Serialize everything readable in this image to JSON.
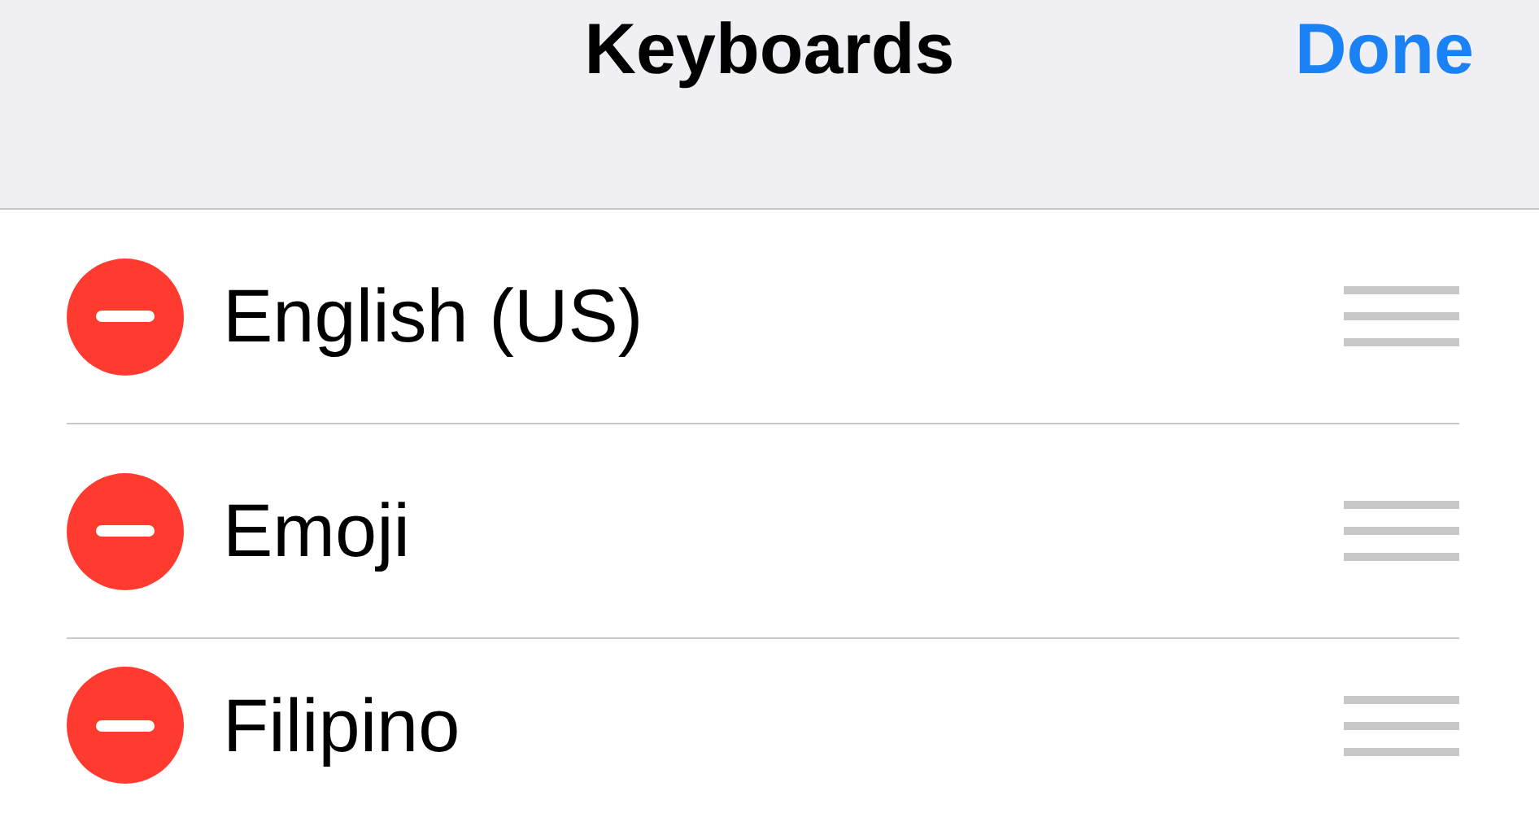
{
  "nav_bar": {
    "title": "Keyboards",
    "done_button": "Done"
  },
  "keyboards": [
    {
      "name": "English (US)"
    },
    {
      "name": "Emoji"
    },
    {
      "name": "Filipino"
    }
  ]
}
